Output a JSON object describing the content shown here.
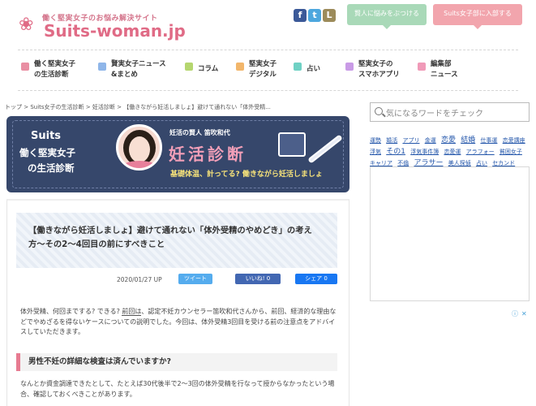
{
  "header": {
    "tagline": "働く堅実女子のお悩み解決サイト",
    "logo_symbol": "❀",
    "logo_text": "Suits-woman.jp",
    "social": {
      "facebook": "f",
      "twitter": "t",
      "line": "L"
    },
    "btn_friend": "賢人に悩みをぶつける",
    "btn_join": "Suits女子部に入部する"
  },
  "nav": [
    {
      "label1": "働く堅実女子",
      "label2": "の生活診断",
      "color": "#e98fa3"
    },
    {
      "label1": "賢実女子ニュース",
      "label2": "&まとめ",
      "color": "#8fb6e9"
    },
    {
      "label1": "コラム",
      "label2": "",
      "color": "#b5d66f"
    },
    {
      "label1": "堅実女子",
      "label2": "デジタル",
      "color": "#f2b66b"
    },
    {
      "label1": "占い",
      "label2": "",
      "color": "#6fd1c4"
    },
    {
      "label1": "堅実女子の",
      "label2": "スマホアプリ",
      "color": "#c99be6"
    },
    {
      "label1": "編集部",
      "label2": "ニュース",
      "color": "#f09ab8"
    }
  ],
  "breadcrumb": [
    "トップ",
    "Suits女子の生活診断",
    "妊活診断",
    "【働きながら妊活しましょ】避けて通れない「体外受精..."
  ],
  "banner": {
    "suits": "Suits",
    "sub1": "働く堅実女子",
    "sub2": "の生活診断",
    "author": "妊活の賢人  笛吹和代",
    "title": "妊活診断",
    "subtitle": "基礎体温、計ってる? 働きながら妊活しましょ"
  },
  "article": {
    "title": "【働きながら妊活しましょ】避けて通れない「体外受精のやめどき」の考え方〜その2〜4回目の前にすべきこと",
    "date": "2020/01/27 UP",
    "tweet": "ツイート",
    "like": "いいね! 0",
    "share": "シェア 0",
    "intro_a": "体外受精、何回までする? できる? ",
    "intro_link": "前回は",
    "intro_b": "、認定不妊カウンセラー笛吹和代さんから、前回、経済的な理由などでやめざるを得ないケースについての説明でした。今回は、体外受精3回目を受ける前の注意点をアドバイスしていただきます。",
    "h2": "男性不妊の詳細な検査は済んでいますか?",
    "body": "なんとか資金調達できたとして、たとえば30代後半で2〜3回の体外受精を行なって授からなかったという場合、確認しておくべきことがあります。"
  },
  "sidebar": {
    "search_placeholder": "気になるワードをチェック",
    "tags": [
      {
        "t": "運勢",
        "big": false
      },
      {
        "t": "婚活",
        "big": false
      },
      {
        "t": "アプリ",
        "big": false
      },
      {
        "t": "金運",
        "big": false
      },
      {
        "t": "恋愛",
        "big": true
      },
      {
        "t": "結婚",
        "big": true
      },
      {
        "t": "仕事運",
        "big": false
      },
      {
        "t": "恋愛講座",
        "big": false
      },
      {
        "t": "浮気",
        "big": false
      },
      {
        "t": "その1",
        "big": true
      },
      {
        "t": "浮気事件簿",
        "big": false
      },
      {
        "t": "恋愛運",
        "big": false
      },
      {
        "t": "アラフォー",
        "big": false
      },
      {
        "t": "貧困女子",
        "big": false
      },
      {
        "t": "キャリア",
        "big": false
      },
      {
        "t": "不倫",
        "big": false
      },
      {
        "t": "アラサー",
        "big": true
      },
      {
        "t": "美人探偵",
        "big": false
      },
      {
        "t": "占い",
        "big": false
      },
      {
        "t": "セカンド",
        "big": false
      }
    ],
    "ad_label": "ⓘ",
    "ad_close": "✕"
  }
}
